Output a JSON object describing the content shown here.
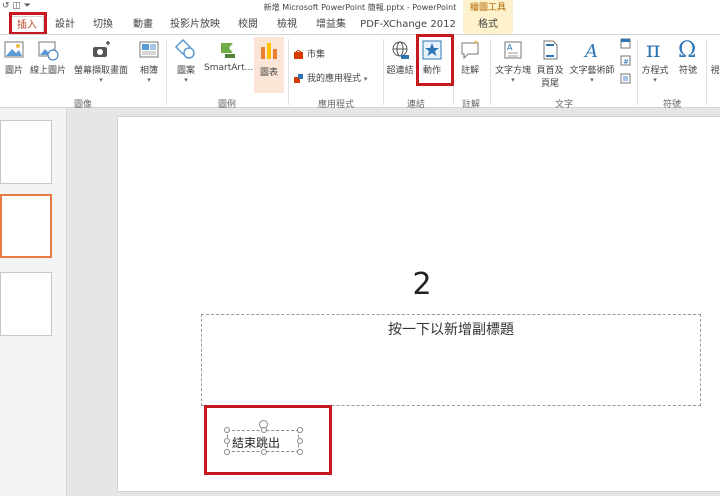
{
  "titlebar": {
    "qat": "↺ ◫ ⏷",
    "title": "新增 Microsoft PowerPoint 簡報.pptx - PowerPoint",
    "context_title": "繪圖工具"
  },
  "tabs": [
    {
      "label": "插入",
      "key": "insert"
    },
    {
      "label": "設計",
      "key": "design"
    },
    {
      "label": "切換",
      "key": "transitions"
    },
    {
      "label": "動畫",
      "key": "animations"
    },
    {
      "label": "投影片放映",
      "key": "slideshow"
    },
    {
      "label": "校閱",
      "key": "review"
    },
    {
      "label": "檢視",
      "key": "view"
    },
    {
      "label": "增益集",
      "key": "addins"
    },
    {
      "label": "PDF-XChange 2012",
      "key": "pdfx"
    },
    {
      "label": "格式",
      "key": "format"
    }
  ],
  "ribbon": {
    "picture": "圖片",
    "online_picture": "線上圖片",
    "screenshot": "螢幕擷取畫面",
    "album": "相簿",
    "group_images": "圖像",
    "shapes": "圖案",
    "smartart": "SmartArt...",
    "chart": "圖表",
    "group_illustrations": "圖例",
    "store": "市集",
    "my_apps": "我的應用程式",
    "group_apps": "應用程式",
    "hyperlink": "超連結",
    "action": "動作",
    "group_links": "連結",
    "comment": "註解",
    "group_comments": "註解",
    "textbox": "文字方塊",
    "header_footer_1": "頁首及",
    "header_footer_2": "頁尾",
    "wordart": "文字藝術師",
    "group_text": "文字",
    "equation": "方程式",
    "symbol": "符號",
    "group_symbols": "符號",
    "cut_off": "視"
  },
  "slide": {
    "title": "2",
    "subtitle_placeholder": "按一下以新增副標題",
    "button_text": "結束跳出"
  }
}
